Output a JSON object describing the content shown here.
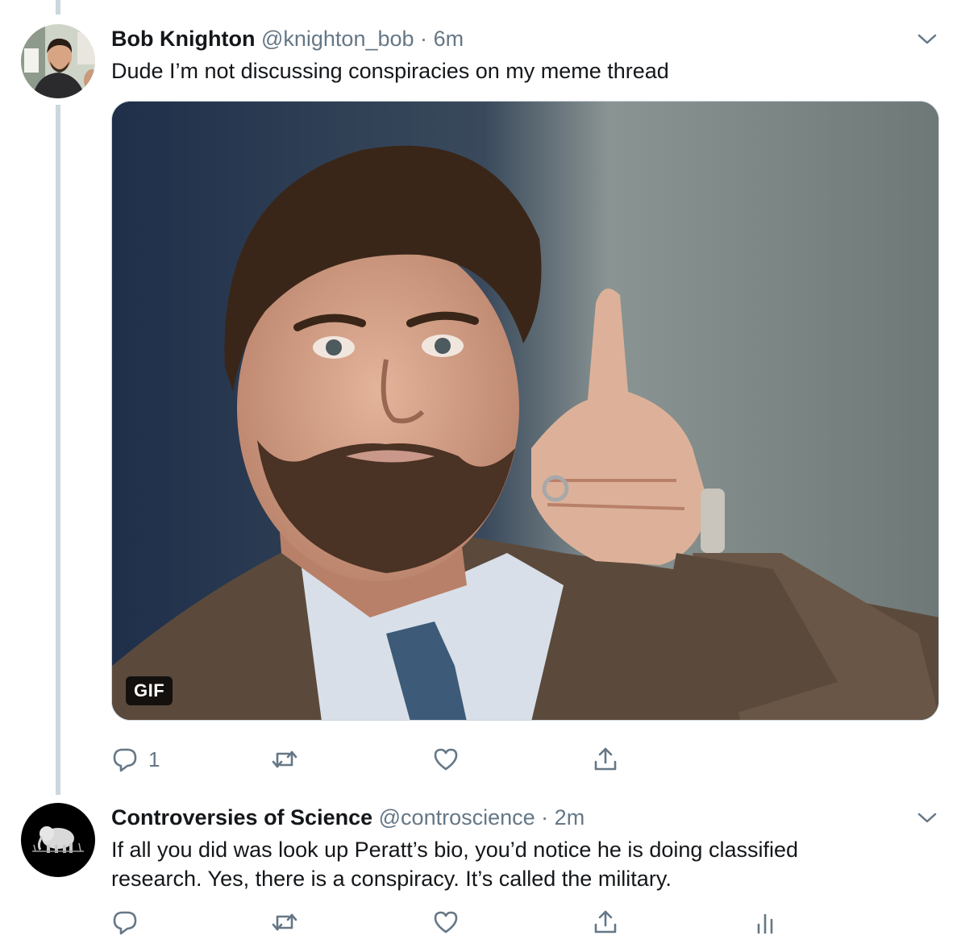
{
  "tweets": [
    {
      "name": "Bob Knighton",
      "handle": "@knighton_bob",
      "separator": "·",
      "time": "6m",
      "text": "Dude I’m not discussing conspiracies on my meme thread",
      "media_badge": "GIF",
      "reply_count": "1",
      "icons": [
        "reply-icon",
        "retweet-icon",
        "like-icon",
        "share-icon",
        "chevron-down-icon"
      ]
    },
    {
      "name": "Controversies of Science",
      "handle": "@controscience",
      "separator": "·",
      "time": "2m",
      "text": "If all you did was look up Peratt’s bio, you’d notice he is doing classified research. Yes, there is a conspiracy. It’s called the military.",
      "icons": [
        "reply-icon",
        "retweet-icon",
        "like-icon",
        "share-icon",
        "analytics-icon",
        "chevron-down-icon"
      ]
    }
  ],
  "colors": {
    "text": "#14171a",
    "secondary": "#657786",
    "thread_line": "#ccd6dd"
  }
}
